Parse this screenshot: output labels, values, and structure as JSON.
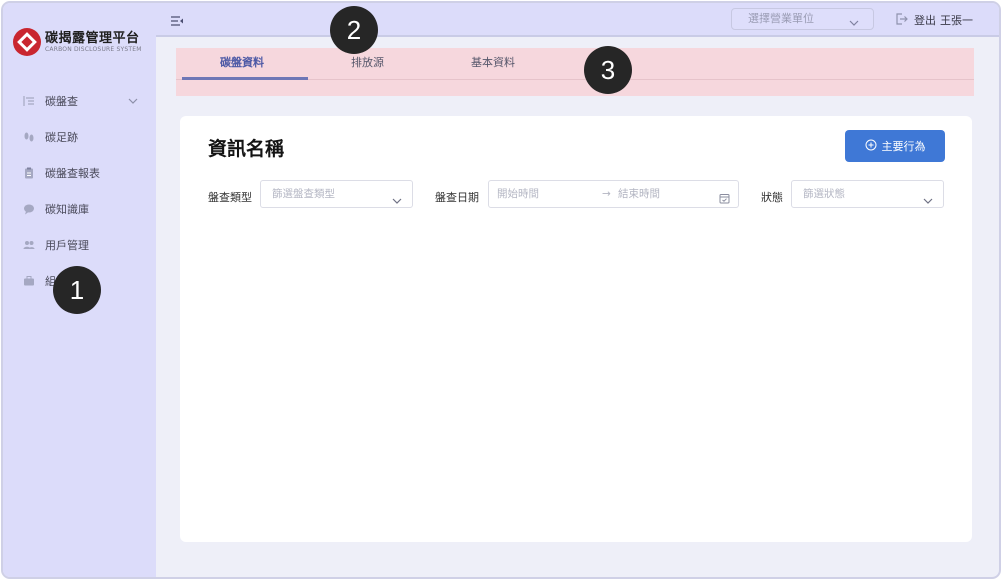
{
  "app": {
    "logo_title": "碳揭露管理平台",
    "logo_subtitle": "CARBON DISCLOSURE SYSTEM",
    "brand_color": "#c9262f"
  },
  "sidebar": {
    "items": [
      {
        "label": "碳盤查",
        "icon": "list-tree-icon",
        "has_chevron": true
      },
      {
        "label": "碳足跡",
        "icon": "footprint-icon"
      },
      {
        "label": "碳盤查報表",
        "icon": "clipboard-icon"
      },
      {
        "label": "碳知識庫",
        "icon": "chat-bubble-icon"
      },
      {
        "label": "用戶管理",
        "icon": "users-icon"
      },
      {
        "label": "組",
        "icon": "briefcase-icon"
      }
    ]
  },
  "topbar": {
    "unit_select_placeholder": "選擇營業單位",
    "logout_label": "登出",
    "user_name": "王張一"
  },
  "tabs": [
    {
      "label": "碳盤資料",
      "active": true
    },
    {
      "label": "排放源",
      "active": false
    },
    {
      "label": "基本資料",
      "active": false
    }
  ],
  "main": {
    "title": "資訊名稱",
    "primary_button": "主要行為",
    "filters": {
      "type_label": "盤查類型",
      "type_placeholder": "篩選盤查類型",
      "date_label": "盤查日期",
      "date_start_placeholder": "開始時間",
      "date_separator": "→",
      "date_end_placeholder": "結束時間",
      "status_label": "狀態",
      "status_placeholder": "篩選狀態"
    }
  },
  "markers": [
    "1",
    "2",
    "3"
  ],
  "colors": {
    "sidebar_bg": "#dcdcfa",
    "tabbar_highlight": "#f6d7dd",
    "primary": "#3f78d6",
    "active_tab": "#4e5aa6"
  }
}
